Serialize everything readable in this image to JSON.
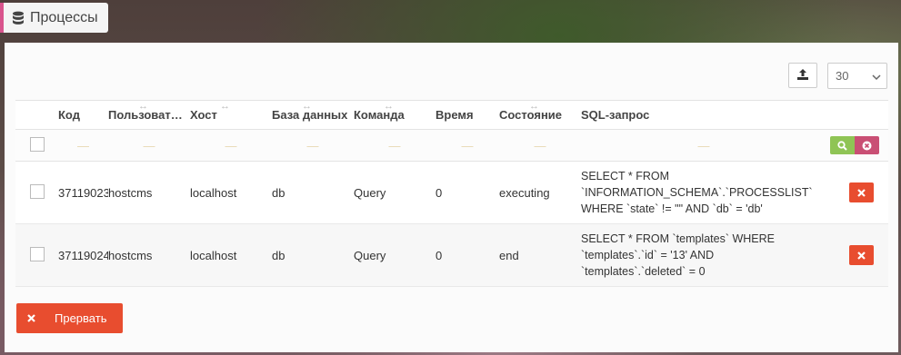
{
  "tab": {
    "title": "Процессы",
    "icon": "database-icon"
  },
  "toolbar": {
    "export_icon": "upload-icon",
    "page_size": "30"
  },
  "table": {
    "columns": [
      {
        "key": "id",
        "label": "Код",
        "resizable": false
      },
      {
        "key": "user",
        "label": "Пользователь",
        "resizable": true
      },
      {
        "key": "host",
        "label": "Хост",
        "resizable": true
      },
      {
        "key": "db",
        "label": "База данных",
        "resizable": true
      },
      {
        "key": "command",
        "label": "Команда",
        "resizable": true
      },
      {
        "key": "time",
        "label": "Время",
        "resizable": false
      },
      {
        "key": "state",
        "label": "Состояние",
        "resizable": true
      },
      {
        "key": "sql",
        "label": "SQL-запрос",
        "resizable": false
      }
    ],
    "filter_placeholder": "—",
    "rows": [
      {
        "id": "37119023",
        "user": "hostcms",
        "host": "localhost",
        "db": "db",
        "command": "Query",
        "time": "0",
        "state": "executing",
        "sql": [
          "SELECT * FROM",
          "`INFORMATION_SCHEMA`.`PROCESSLIST`",
          "WHERE `state` != \"\" AND `db` = 'db'"
        ]
      },
      {
        "id": "37119024",
        "user": "hostcms",
        "host": "localhost",
        "db": "db",
        "command": "Query",
        "time": "0",
        "state": "end",
        "sql": [
          "SELECT * FROM `templates` WHERE",
          "`templates`.`id` = '13' AND",
          "`templates`.`deleted` = 0"
        ]
      }
    ]
  },
  "footer": {
    "abort_label": "Прервать"
  },
  "colors": {
    "accent": "#d9548d",
    "danger": "#e84d2f",
    "success": "#8fc455",
    "clear": "#c94f74"
  }
}
